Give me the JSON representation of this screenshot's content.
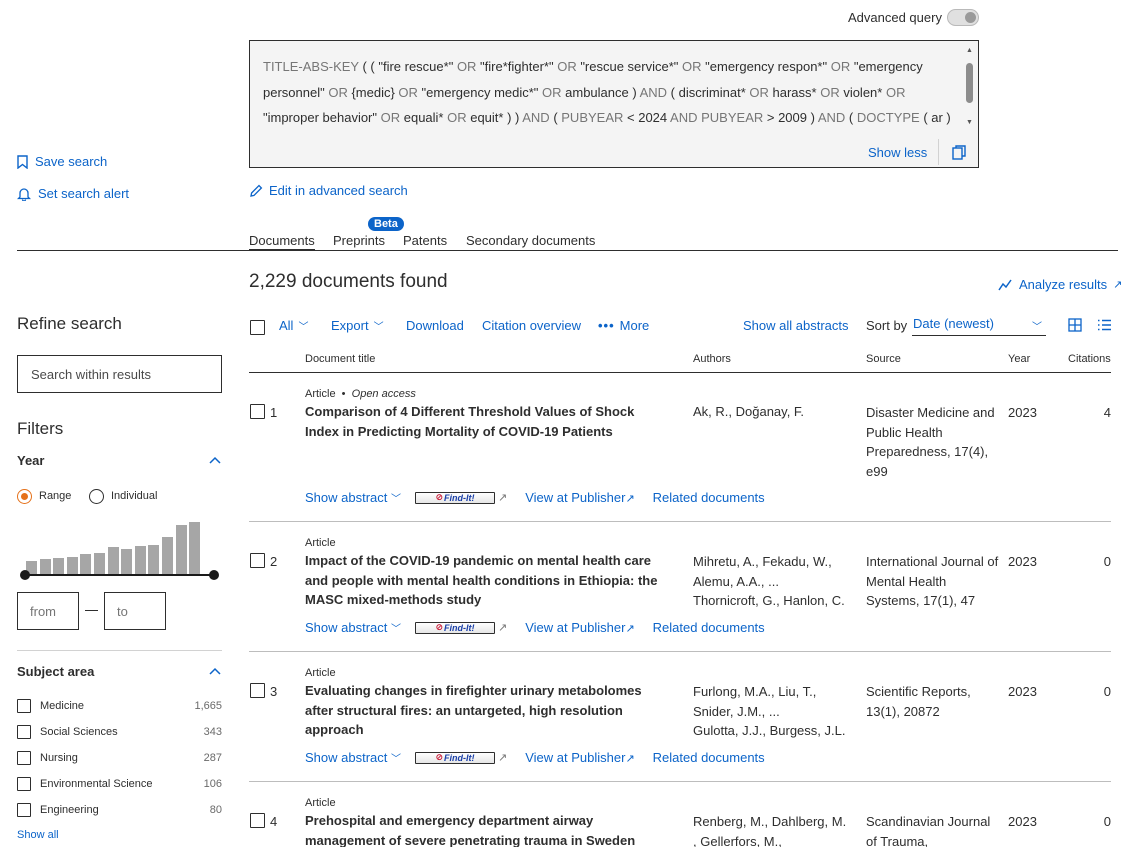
{
  "query": {
    "advanced_label": "Advanced query",
    "line1_a": "TITLE-ABS-KEY",
    "line1_b": " ( ( \"fire rescue*\" ",
    "line1_c": "OR",
    "line1_d": " \"fire*fighter*\" ",
    "line1_e": "OR",
    "line1_f": " \"rescue service*\" ",
    "line1_g": "OR",
    "line1_h": " \"emergency respon*\" ",
    "line1_i": "OR",
    "line1_j": " \"emergency",
    "line2_a": "personnel\" ",
    "line2_b": "OR",
    "line2_c": " {medic} ",
    "line2_d": "OR",
    "line2_e": " \"emergency medic*\" ",
    "line2_f": "OR",
    "line2_g": " ambulance ) ",
    "line2_h": "AND",
    "line2_i": " ( discriminat* ",
    "line2_j": "OR",
    "line2_k": " harass* ",
    "line2_l": "OR",
    "line2_m": " violen* ",
    "line2_n": "OR",
    "line3_a": "\"improper behavior\" ",
    "line3_b": "OR",
    "line3_c": " equali* ",
    "line3_d": "OR",
    "line3_e": " equit* ) ) ",
    "line3_f": "AND",
    "line3_g": " ( ",
    "line3_h": "PUBYEAR",
    "line3_i": " < 2024 ",
    "line3_j": "AND",
    "line3_k": " ",
    "line3_l": "PUBYEAR",
    "line3_m": " > 2009 ) ",
    "line3_n": "AND",
    "line3_o": " ( ",
    "line3_p": "DOCTYPE",
    "line3_q": " ( ar )",
    "show_less": "Show less"
  },
  "left_links": {
    "save_search": "Save search",
    "set_alert": "Set search alert"
  },
  "edit_advanced": "Edit in advanced search",
  "tabs": [
    {
      "label": "Documents"
    },
    {
      "label": "Preprints"
    },
    {
      "label": "Patents"
    },
    {
      "label": "Secondary documents"
    }
  ],
  "beta_badge": "Beta",
  "results_count": "2,229 documents found",
  "analyze_results": "Analyze results",
  "toolbar": {
    "all": "All",
    "export": "Export",
    "download": "Download",
    "citation_overview": "Citation overview",
    "more": "More",
    "show_all_abstracts": "Show all abstracts",
    "sort_by": "Sort by",
    "sort_value": "Date (newest)"
  },
  "columns": {
    "title": "Document title",
    "authors": "Authors",
    "source": "Source",
    "year": "Year",
    "citations": "Citations"
  },
  "row_links": {
    "show_abstract": "Show abstract",
    "findit": "Find-It!",
    "view_publisher": "View at Publisher",
    "related": "Related documents"
  },
  "rows": [
    {
      "num": "1",
      "type": "Article",
      "open_access": "Open access",
      "title1": "Comparison of 4 Different Threshold Values of Shock",
      "title2": "Index in Predicting Mortality of COVID-19 Patients",
      "title3": "",
      "auth1": "Ak, R., Doğanay, F.",
      "auth2": "",
      "auth3": "",
      "src1": "Disaster Medicine and",
      "src2": "Public Health",
      "src3": "Preparedness, 17(4),",
      "src4": "e99",
      "year": "2023",
      "citations": "4"
    },
    {
      "num": "2",
      "type": "Article",
      "open_access": "",
      "title1": "Impact of the COVID-19 pandemic on mental health care",
      "title2": "and people with mental health conditions in Ethiopia: the",
      "title3": "MASC mixed-methods study",
      "auth1": "Mihretu, A., Fekadu, W.,",
      "auth2": "Alemu, A.A., ...",
      "auth3": "Thornicroft, G., Hanlon, C.",
      "src1": "International Journal of",
      "src2": "Mental Health",
      "src3": "Systems, 17(1), 47",
      "src4": "",
      "year": "2023",
      "citations": "0"
    },
    {
      "num": "3",
      "type": "Article",
      "open_access": "",
      "title1": "Evaluating changes in firefighter urinary metabolomes",
      "title2": "after structural fires: an untargeted, high resolution",
      "title3": "approach",
      "auth1": "Furlong, M.A., Liu, T.,",
      "auth2": "Snider, J.M., ...",
      "auth3": "Gulotta, J.J., Burgess, J.L.",
      "src1": "Scientific Reports,",
      "src2": "13(1), 20872",
      "src3": "",
      "src4": "",
      "year": "2023",
      "citations": "0"
    },
    {
      "num": "4",
      "type": "Article",
      "open_access": "",
      "title1": "Prehospital and emergency department airway",
      "title2": "management of severe penetrating trauma in Sweden",
      "title3": "",
      "auth1": "Renberg, M., Dahlberg, M.",
      "auth2": ", Gellerfors, M.,",
      "auth3": "",
      "src1": "Scandinavian Journal",
      "src2": "of Trauma,",
      "src3": "",
      "src4": "",
      "year": "2023",
      "citations": "0"
    }
  ],
  "refine": {
    "title": "Refine search",
    "search_placeholder": "Search within results",
    "filters": "Filters",
    "year_head": "Year",
    "range": "Range",
    "individual": "Individual",
    "year_bars": [
      10,
      11,
      12,
      13,
      15,
      16,
      20,
      19,
      21,
      22,
      28,
      37,
      39
    ],
    "from_placeholder": "from",
    "to_placeholder": "to",
    "subject_head": "Subject area",
    "subjects": [
      {
        "name": "Medicine",
        "count": "1,665"
      },
      {
        "name": "Social Sciences",
        "count": "343"
      },
      {
        "name": "Nursing",
        "count": "287"
      },
      {
        "name": "Environmental Science",
        "count": "106"
      },
      {
        "name": "Engineering",
        "count": "80"
      }
    ],
    "show_all": "Show all"
  }
}
